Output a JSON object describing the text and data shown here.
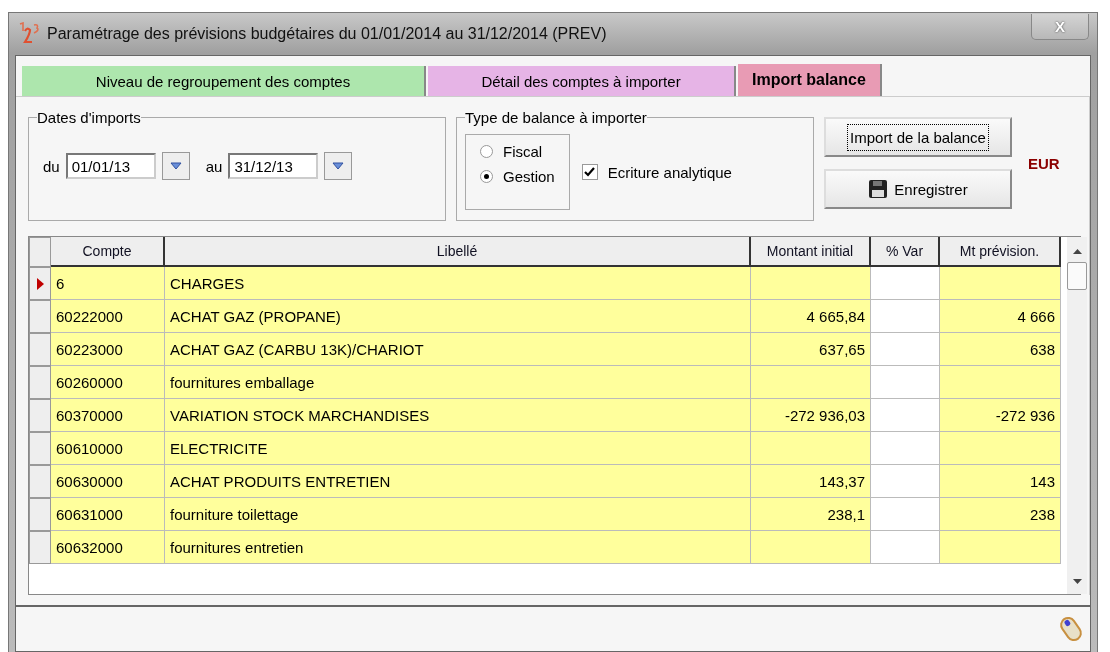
{
  "window": {
    "title": "Paramétrage des prévisions budgétaires du 01/01/2014 au 31/12/2014 (PREV)",
    "close": "X"
  },
  "tabs": [
    {
      "label": "Niveau de regroupement des comptes",
      "selected": false,
      "color": "#ade6ad"
    },
    {
      "label": "Détail des comptes à importer",
      "selected": false,
      "color": "#e6b4e6"
    },
    {
      "label": "Import balance",
      "selected": true,
      "color": "#e89bb4"
    }
  ],
  "dates": {
    "legend": "Dates d'imports",
    "from_label": "du",
    "from": "01/01/13",
    "to_label": "au",
    "to": "31/12/13"
  },
  "balance_type": {
    "legend": "Type de balance à importer",
    "options": [
      {
        "label": "Fiscal",
        "selected": false
      },
      {
        "label": "Gestion",
        "selected": true
      }
    ],
    "analytic": {
      "label": "Ecriture analytique",
      "checked": true
    }
  },
  "buttons": {
    "import": "Import de la balance",
    "save": "Enregistrer"
  },
  "currency": "EUR",
  "table": {
    "columns": [
      "Compte",
      "Libellé",
      "Montant initial",
      "% Var",
      "Mt prévision."
    ],
    "rows": [
      {
        "selected": true,
        "compte": "6",
        "libelle": "CHARGES"
      },
      {
        "selected": false,
        "compte": "60222000",
        "libelle": "ACHAT GAZ (PROPANE)",
        "montant": "4 665,84",
        "prevision": "4 666"
      },
      {
        "selected": false,
        "compte": "60223000",
        "libelle": "ACHAT GAZ (CARBU 13K)/CHARIOT",
        "montant": "637,65",
        "prevision": "638"
      },
      {
        "selected": false,
        "compte": "60260000",
        "libelle": "fournitures emballage"
      },
      {
        "selected": false,
        "compte": "60370000",
        "libelle": "VARIATION STOCK MARCHANDISES",
        "montant": "-272 936,03",
        "prevision": "-272 936"
      },
      {
        "selected": false,
        "compte": "60610000",
        "libelle": "ELECTRICITE"
      },
      {
        "selected": false,
        "compte": "60630000",
        "libelle": "ACHAT PRODUITS ENTRETIEN",
        "montant": "143,37",
        "prevision": "143"
      },
      {
        "selected": false,
        "compte": "60631000",
        "libelle": "fourniture toilettage",
        "montant": "238,1",
        "prevision": "238"
      },
      {
        "selected": false,
        "compte": "60632000",
        "libelle": "fournitures entretien"
      }
    ]
  }
}
